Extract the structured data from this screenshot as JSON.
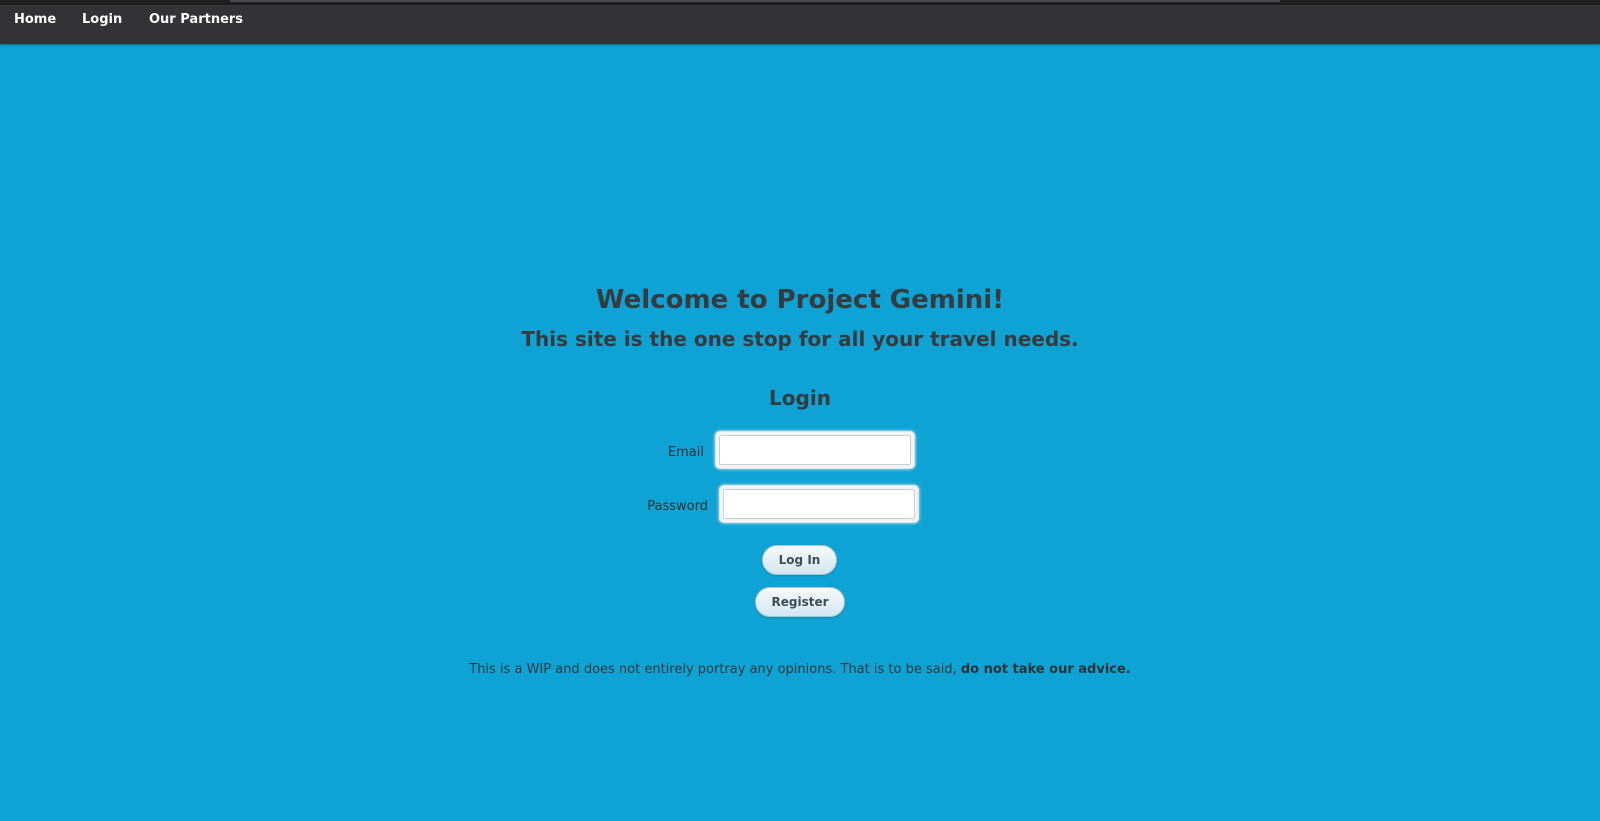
{
  "nav": {
    "items": [
      {
        "label": "Home"
      },
      {
        "label": "Login"
      },
      {
        "label": "Our Partners"
      }
    ]
  },
  "main": {
    "title": "Welcome to Project Gemini!",
    "tagline": "This site is the one stop for all your travel needs."
  },
  "login_form": {
    "heading": "Login",
    "email_label": "Email",
    "email_value": "",
    "password_label": "Password",
    "password_value": "",
    "login_button": "Log In",
    "register_button": "Register"
  },
  "footer": {
    "disclaimer_text": "This is a WIP and does not entirely portray any opinions. That is to be said, ",
    "disclaimer_bold": "do not take our advice."
  },
  "colors": {
    "background": "#0ea3d4",
    "nav_background": "#333234",
    "heading_text": "#363b3f"
  }
}
